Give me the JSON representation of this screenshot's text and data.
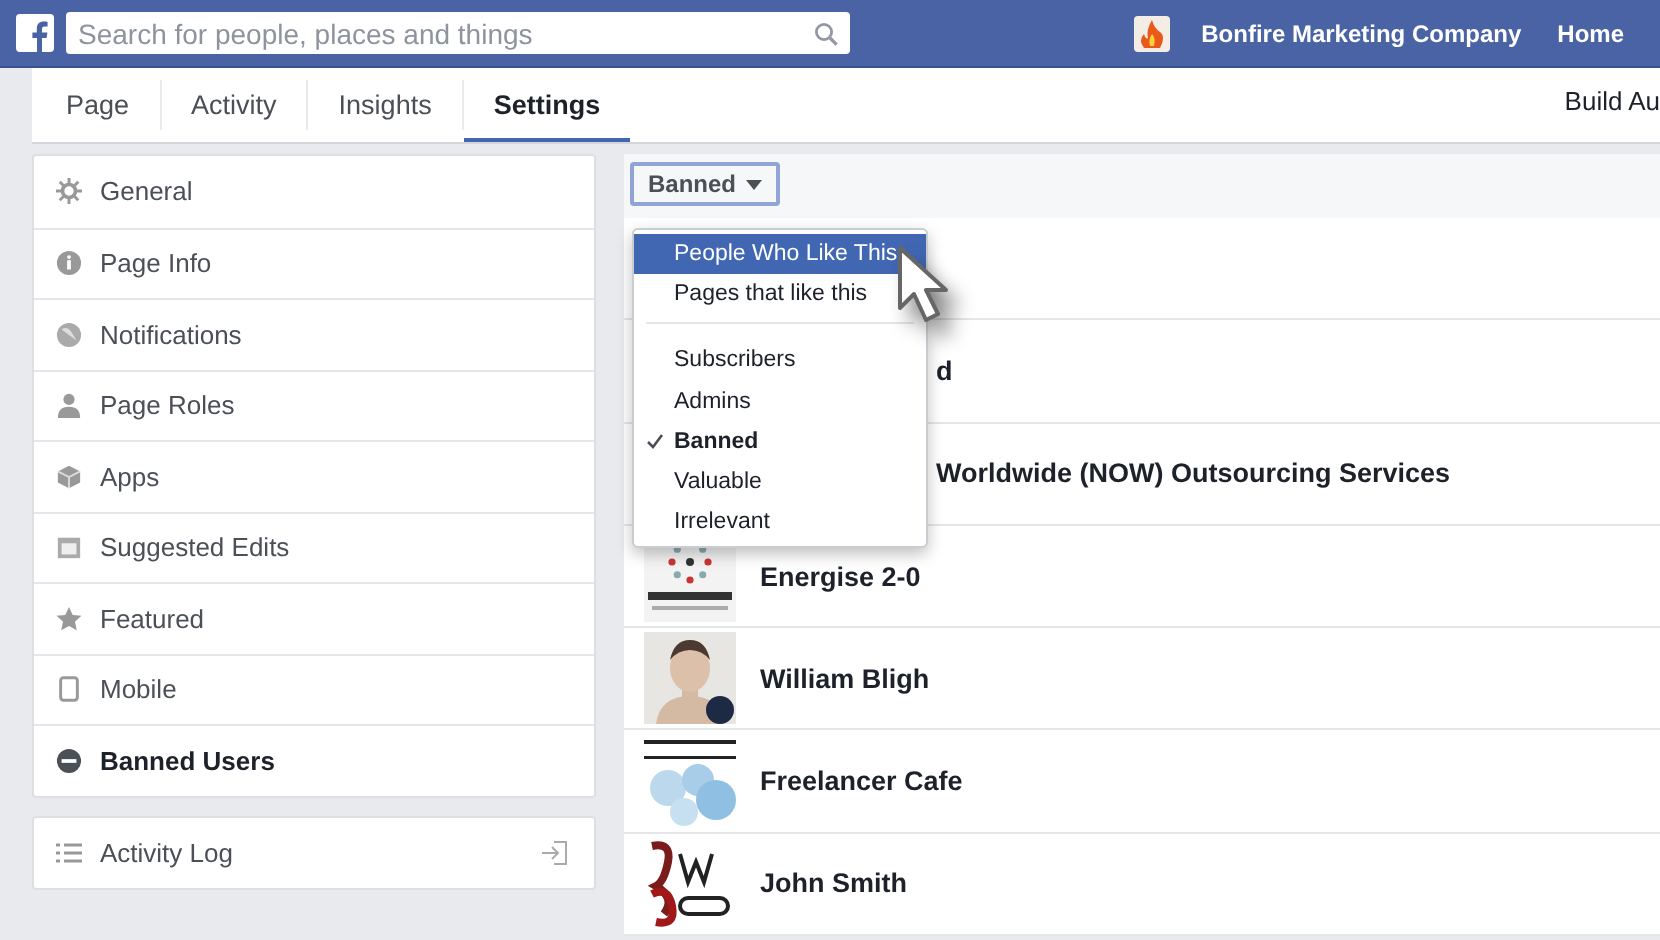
{
  "top_bar": {
    "search": {
      "placeholder": "Search for people, places and things"
    },
    "page_name": "Bonfire Marketing Company",
    "home": "Home"
  },
  "tabs": [
    {
      "label": "Page",
      "selected": false
    },
    {
      "label": "Activity",
      "selected": false
    },
    {
      "label": "Insights",
      "selected": false
    },
    {
      "label": "Settings",
      "selected": true
    }
  ],
  "build_link": "Build Au",
  "sidebar": {
    "items": [
      {
        "label": "General",
        "selected": false
      },
      {
        "label": "Page Info",
        "selected": false
      },
      {
        "label": "Notifications",
        "selected": false
      },
      {
        "label": "Page Roles",
        "selected": false
      },
      {
        "label": "Apps",
        "selected": false
      },
      {
        "label": "Suggested Edits",
        "selected": false
      },
      {
        "label": "Featured",
        "selected": false
      },
      {
        "label": "Mobile",
        "selected": false
      },
      {
        "label": "Banned Users",
        "selected": true
      }
    ],
    "activity_log": "Activity Log"
  },
  "filter": {
    "label": "Banned",
    "expanded": true,
    "options": [
      {
        "label": "People Who Like This",
        "selected": true,
        "checked": false
      },
      {
        "label": "Pages that like this",
        "selected": false,
        "checked": false
      },
      {
        "kind": "separator"
      },
      {
        "label": "Subscribers",
        "selected": false,
        "checked": false
      },
      {
        "label": "Admins",
        "selected": false,
        "checked": false
      },
      {
        "label": "Banned",
        "selected": false,
        "checked": true
      },
      {
        "label": "Valuable",
        "selected": false,
        "checked": false
      },
      {
        "label": "Irrelevant",
        "selected": false,
        "checked": false
      }
    ]
  },
  "people": [
    {
      "covered": true
    },
    {
      "name": "d",
      "covered": true
    },
    {
      "name": "Worldwide (NOW) Outsourcing Services",
      "covered": true
    },
    {
      "name": "Energise 2-0"
    },
    {
      "name": "William Bligh"
    },
    {
      "name": "Freelancer Cafe"
    },
    {
      "name": "John Smith"
    }
  ]
}
